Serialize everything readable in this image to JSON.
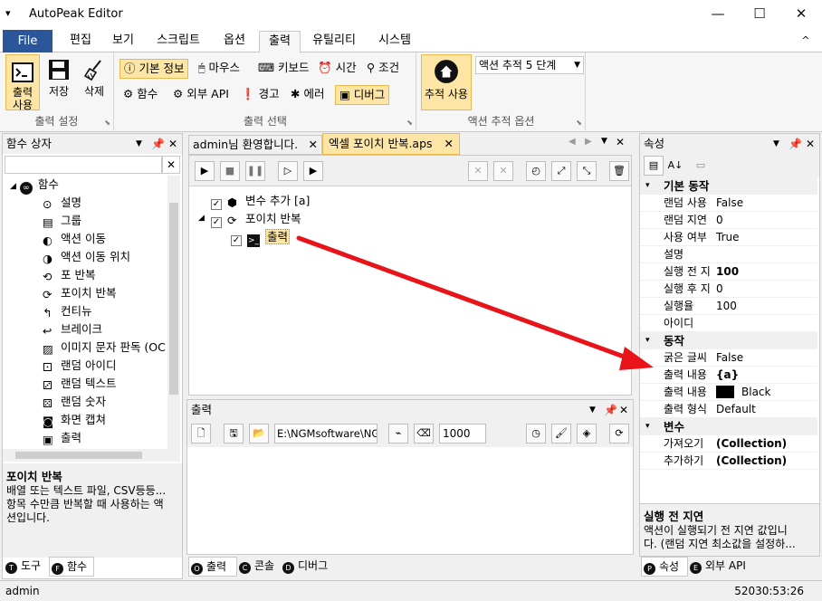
{
  "window": {
    "title": "AutoPeak Editor",
    "minimize": "—",
    "maximize": "☐",
    "close": "✕"
  },
  "menu": {
    "tabs": [
      "File",
      "편집",
      "보기",
      "스크립트",
      "옵션",
      "출력",
      "유틸리티",
      "시스템"
    ],
    "active_index": 5,
    "collapse": "^"
  },
  "ribbon": {
    "group1": {
      "label": "출력 설정",
      "print_button": "출력\n사용",
      "save_button": "저장",
      "delete_button": "삭제"
    },
    "group2": {
      "label": "출력 선택",
      "items": [
        "기본 정보",
        "마우스",
        "키보드",
        "시간",
        "조건",
        "함수",
        "외부 API",
        "경고",
        "에러",
        "디버그"
      ]
    },
    "group3": {
      "label": "액션 추적 옵션",
      "track_button": "추적 사용",
      "dropdown_value": "액션 추적 5 단계"
    }
  },
  "left_panel": {
    "title": "함수 상자",
    "root": "함수",
    "items": [
      "설명",
      "그룹",
      "액션 이동",
      "액션 이동 위치",
      "포 반복",
      "포이치 반복",
      "컨티뉴",
      "브레이크",
      "이미지 문자 판독 (OC",
      "랜덤 아이디",
      "랜덤 텍스트",
      "랜덤 숫자",
      "화면 캡쳐",
      "출력"
    ],
    "desc_title": "포이치 반복",
    "desc_text": "배열 또는 텍스트 파일, CSV등등...\n항목 수만큼 반복할 때 사용하는 액\n션입니다.",
    "bottom_tabs": [
      "도구",
      "함수"
    ]
  },
  "editor": {
    "tabs": [
      "admin님 환영합니다.",
      "엑셀 포이치 반복.aps"
    ],
    "tree": [
      {
        "label": "변수 추가 [a]"
      },
      {
        "label": "포이치 반복"
      },
      {
        "label": "출력"
      }
    ]
  },
  "output_panel": {
    "title": "출력",
    "path": "E:\\NGMsoftware\\NG",
    "number": "1000",
    "bottom_tabs": [
      "출력",
      "콘솔",
      "디버그"
    ]
  },
  "properties": {
    "title": "속성",
    "categories": [
      {
        "name": "기본 동작",
        "rows": [
          [
            "랜덤 사용",
            "False"
          ],
          [
            "랜덤 지연",
            "0"
          ],
          [
            "사용 여부",
            "True"
          ],
          [
            "설명",
            ""
          ],
          [
            "실행 전 지",
            "100"
          ],
          [
            "실행 후 지",
            "0"
          ],
          [
            "실행율",
            "100"
          ],
          [
            "아이디",
            ""
          ]
        ]
      },
      {
        "name": "동작",
        "rows": [
          [
            "굵은 글씨",
            "False"
          ],
          [
            "출력 내용",
            "{a}"
          ],
          [
            "출력 내용",
            "Black"
          ],
          [
            "출력 형식",
            "Default"
          ]
        ]
      },
      {
        "name": "변수",
        "rows": [
          [
            "가져오기",
            "(Collection)"
          ],
          [
            "추가하기",
            "(Collection)"
          ]
        ]
      }
    ],
    "desc_title": "실행 전 지연",
    "desc_text": "액션이 실행되기 전 지연 값입니\n다. (랜덤 지연 최소값을 설정하...",
    "bottom_tabs": [
      "속성",
      "외부 API"
    ]
  },
  "status": {
    "user": "admin",
    "time": "52030:53:26"
  },
  "colors": {
    "accent": "#2b579a",
    "highlight": "#fde6a5",
    "arrow": "#e8141a"
  }
}
